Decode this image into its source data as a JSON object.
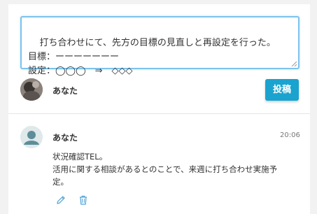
{
  "composer": {
    "text": "打ち合わせにて、先方の目標の見直しと再設定を行った。\n目標：ーーーーーーー\n設定：◯◯◯　⇒　◇◇◇"
  },
  "current_user": {
    "name": "あなた"
  },
  "post_button": {
    "label": "投稿"
  },
  "comments": [
    {
      "author": "あなた",
      "time": "20:06",
      "body": "状況確認TEL。\n活用に関する相談があるとのことで、来週に打ち合わせ実施予\n定。"
    }
  ],
  "colors": {
    "accent": "#1aa3cf",
    "focus_border": "#7cc3ee",
    "icon": "#4fa3d6"
  }
}
